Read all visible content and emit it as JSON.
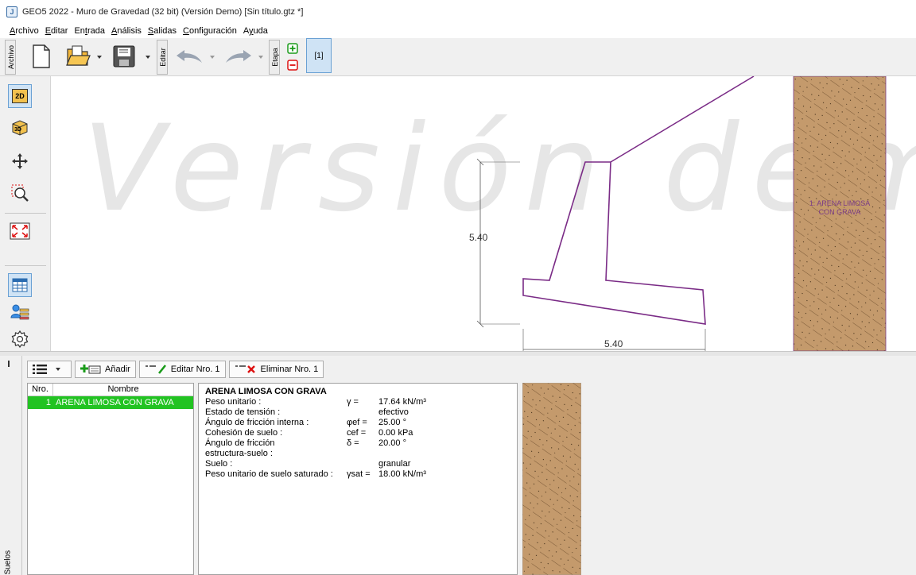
{
  "window": {
    "title": "GEO5 2022 - Muro de Gravedad (32 bit) (Versión Demo) [Sin título.gtz *]",
    "icon": "geo5-app-icon"
  },
  "menu": [
    {
      "pre": "",
      "ul": "A",
      "post": "rchivo"
    },
    {
      "pre": "",
      "ul": "E",
      "post": "ditar"
    },
    {
      "pre": "En",
      "ul": "t",
      "post": "rada"
    },
    {
      "pre": "",
      "ul": "A",
      "post": "nálisis"
    },
    {
      "pre": "",
      "ul": "S",
      "post": "alidas"
    },
    {
      "pre": "",
      "ul": "C",
      "post": "onfiguración"
    },
    {
      "pre": "A",
      "ul": "y",
      "post": "uda"
    }
  ],
  "toolbar": {
    "archivo_label": "Archivo",
    "editar_label": "Editar",
    "etapa_label": "Etapa",
    "stage": "[1]"
  },
  "left_toolbar": {
    "btn_2d": "2D",
    "btn_3d": "3D"
  },
  "canvas": {
    "watermark": "Versión dem",
    "dim_height": "5.40",
    "dim_width": "5.40",
    "soil_label_line1": "1: ARENA LIMOSA",
    "soil_label_line2": "CON GRAVA",
    "colors": {
      "wall": "#7a2b86",
      "soil": "#c49a6c"
    }
  },
  "bottom": {
    "side_label": "Suelos",
    "buttons": {
      "add": "Añadir",
      "edit": "Editar Nro. 1",
      "delete": "Eliminar Nro. 1"
    },
    "table": {
      "headers": [
        "Nro.",
        "Nombre"
      ],
      "rows": [
        {
          "nro": "1",
          "nombre": "ARENA LIMOSA CON GRAVA"
        }
      ]
    },
    "properties": {
      "title": "ARENA LIMOSA CON GRAVA",
      "rows": [
        {
          "k": "Peso unitario :",
          "s": "γ  =",
          "v": "17.64 kN/m³"
        },
        {
          "k": "Estado de tensión :",
          "s": "",
          "v": "efectivo"
        },
        {
          "k": "Ángulo de fricción interna :",
          "s": "φef =",
          "v": "25.00 °"
        },
        {
          "k": "Cohesión de suelo :",
          "s": "cef =",
          "v": "0.00 kPa"
        },
        {
          "k": "Ángulo de fricción",
          "s": "δ  =",
          "v": "20.00 °"
        },
        {
          "k": "estructura-suelo :",
          "s": "",
          "v": ""
        },
        {
          "k": "Suelo :",
          "s": "",
          "v": "granular"
        },
        {
          "k": "Peso unitario de suelo saturado :",
          "s": "γsat =",
          "v": "18.00 kN/m³"
        }
      ]
    }
  }
}
